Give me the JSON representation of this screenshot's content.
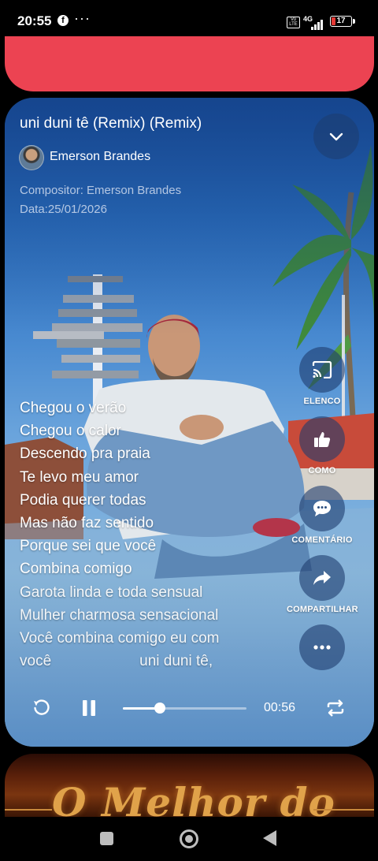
{
  "status_bar": {
    "time": "20:55",
    "notification_icons": [
      "facebook-icon",
      "more-dots-icon"
    ],
    "dots": "···",
    "network": "4G",
    "volte": "Vo LTE",
    "battery": "17",
    "battery_color": "#e53935"
  },
  "top_card": {
    "color": "#ec4352"
  },
  "player": {
    "title": "uni duni tê  (Remix) (Remix)",
    "author": "Emerson Brandes",
    "composer": "Compositor: Emerson Brandes",
    "date": "Data:25/01/2026",
    "lyrics": [
      "Chegou o verão",
      "Chegou o calor",
      "Descendo pra praia",
      "Te levo meu amor",
      "Podia querer todas",
      "Mas não faz sentido",
      "Porque sei que você",
      "Combina comigo",
      "Garota linda e toda sensual",
      "Mulher charmosa sensacional",
      "Você combina comigo eu com"
    ],
    "lyric_last_left": "você",
    "lyric_last_right": "uni duni tê,",
    "actions": {
      "cast": "ELENCO",
      "like": "COMO",
      "comment": "COMENTÁRIO",
      "share": "COMPARTILHAR"
    },
    "playback": {
      "current_time": "00:56",
      "progress_fraction": 0.3,
      "state": "playing"
    }
  },
  "next_item": {
    "title": "O Melhor do",
    "accent_color": "#e0a24a"
  },
  "nav_bar": {
    "buttons": [
      "recents-square",
      "home-circle",
      "back-triangle"
    ]
  }
}
